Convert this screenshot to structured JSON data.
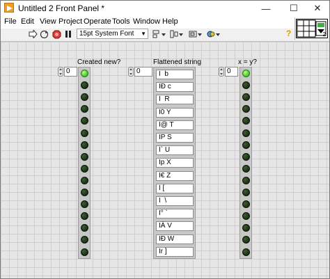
{
  "window": {
    "title": "Untitled 2 Front Panel *",
    "controls": {
      "minimize": "—",
      "maximize": "☐",
      "close": "✕"
    }
  },
  "menu": [
    "File",
    "Edit",
    "View",
    "Project",
    "Operate",
    "Tools",
    "Window",
    "Help"
  ],
  "toolbar": {
    "font": "15pt System Font",
    "vi_icon_number": "2"
  },
  "arrays": {
    "created_new": {
      "label": "Created new?",
      "index": "0",
      "leds": [
        true,
        false,
        false,
        false,
        false,
        false,
        false,
        false,
        false,
        false,
        false,
        false,
        false,
        false,
        false,
        false
      ]
    },
    "flattened": {
      "label": "Flattened string",
      "index": "0",
      "values": [
        "I  b",
        "IÐ c",
        "I  R",
        "I0 Y",
        "I@ T",
        "IP S",
        "I` U",
        "Ip X",
        "I€ Z",
        "I [",
        "I  \\",
        "I° `",
        "IÀ V",
        "IÐ W",
        "Ir ]"
      ]
    },
    "x_eq_y": {
      "label": "x = y?",
      "index": "0",
      "leds": [
        true,
        false,
        false,
        false,
        false,
        false,
        false,
        false,
        false,
        false,
        false,
        false,
        false,
        false,
        false,
        false
      ]
    }
  }
}
